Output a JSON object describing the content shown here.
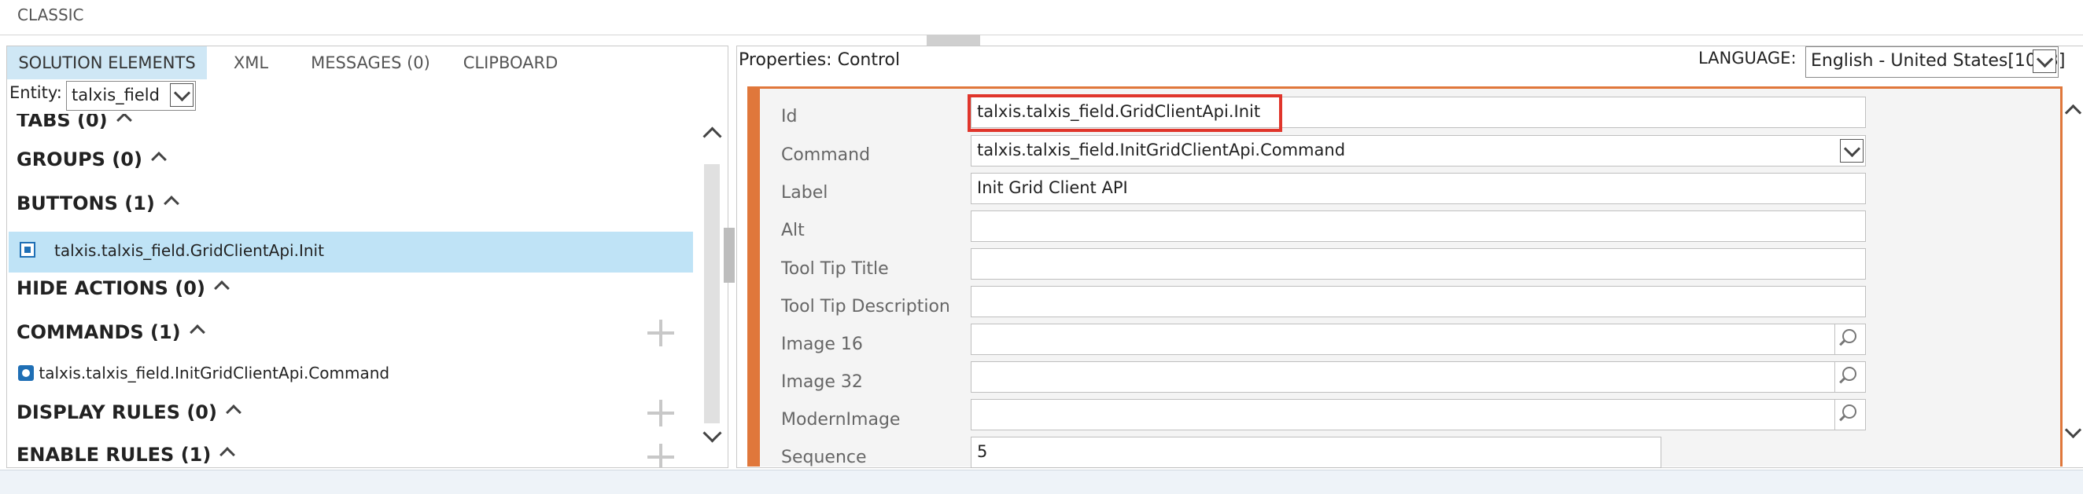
{
  "classic": {
    "label": "CLASSIC"
  },
  "left_panel": {
    "tabs": [
      {
        "label": "SOLUTION ELEMENTS",
        "active": true
      },
      {
        "label": "XML",
        "active": false
      },
      {
        "label": "MESSAGES (0)",
        "active": false
      },
      {
        "label": "CLIPBOARD",
        "active": false
      }
    ],
    "entity": {
      "label": "Entity:",
      "value": "talxis_field"
    },
    "sections": {
      "tabs": "TABS (0)",
      "groups": "GROUPS (0)",
      "buttons": "BUTTONS (1)",
      "hide_actions": "HIDE ACTIONS (0)",
      "commands": "COMMANDS (1)",
      "display_rules": "DISPLAY RULES (0)",
      "enable_rules": "ENABLE RULES (1)"
    },
    "items": {
      "button": "talxis.talxis_field.GridClientApi.Init",
      "command": "talxis.talxis_field.InitGridClientApi.Command"
    }
  },
  "right_panel": {
    "title": "Properties: Control",
    "language_label": "LANGUAGE:",
    "language_value": "English - United States[1033]",
    "properties": [
      {
        "label": "Id",
        "value": "talxis.talxis_field.GridClientApi.Init"
      },
      {
        "label": "Command",
        "value": "talxis.talxis_field.InitGridClientApi.Command"
      },
      {
        "label": "Label",
        "value": "Init Grid Client API"
      },
      {
        "label": "Alt",
        "value": ""
      },
      {
        "label": "Tool Tip Title",
        "value": ""
      },
      {
        "label": "Tool Tip Description",
        "value": ""
      },
      {
        "label": "Image 16",
        "value": ""
      },
      {
        "label": "Image 32",
        "value": ""
      },
      {
        "label": "ModernImage",
        "value": ""
      },
      {
        "label": "Sequence",
        "value": "5"
      }
    ]
  },
  "colors": {
    "accent": "#e0773b",
    "selection": "#bfe3f6",
    "tab_active": "#cfe7f5",
    "highlight": "#e0352b"
  }
}
